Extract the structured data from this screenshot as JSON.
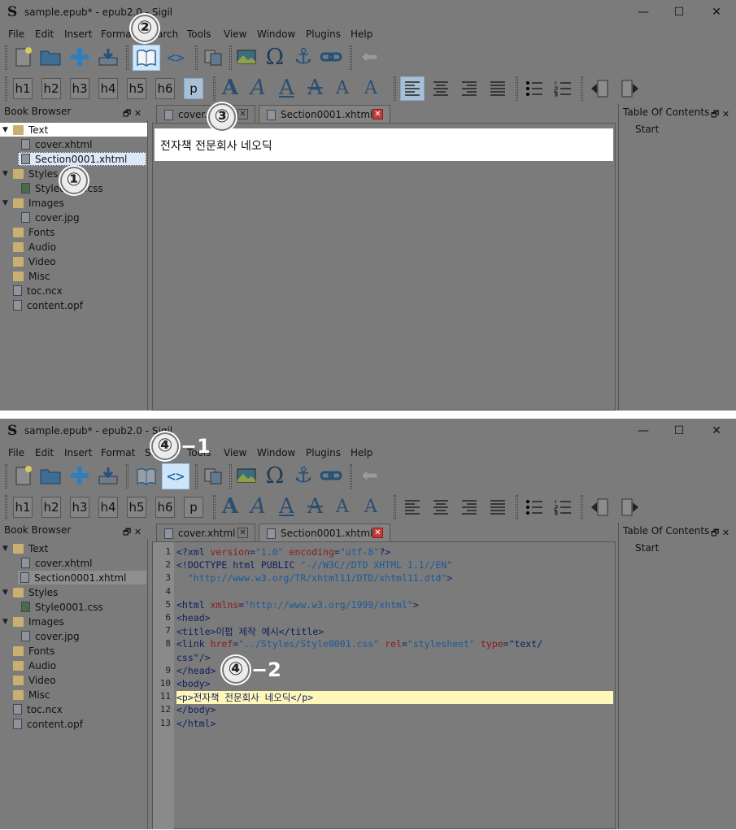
{
  "window_title": "sample.epub* - epub2.0 - Sigil",
  "app_icon": "S",
  "window_controls": {
    "minimize": "—",
    "maximize": "☐",
    "close": "✕"
  },
  "menu": [
    "File",
    "Edit",
    "Insert",
    "Format",
    "Search",
    "Tools",
    "View",
    "Window",
    "Plugins",
    "Help"
  ],
  "heading_buttons": [
    "h1",
    "h2",
    "h3",
    "h4",
    "h5",
    "h6",
    "p"
  ],
  "format_glyphs": [
    "A",
    "A",
    "A",
    "A",
    "A",
    "A"
  ],
  "icons": {
    "new": "new-file-icon",
    "open": "open-folder-icon",
    "add": "add-file-icon",
    "save": "save-icon",
    "book_view": "book-view-icon",
    "code_view": "code-view-icon",
    "metadata": "metadata-icon",
    "image": "insert-image-icon",
    "special_char": "omega-icon",
    "anchor": "anchor-icon",
    "link": "link-icon",
    "back": "back-arrow-icon",
    "align_left": "align-left-icon",
    "align_center": "align-center-icon",
    "align_right": "align-right-icon",
    "justify": "justify-icon",
    "bullet_list": "bullet-list-icon",
    "number_list": "numbered-list-icon",
    "outdent": "outdent-icon",
    "indent": "indent-icon"
  },
  "code_view_glyph": "<>",
  "omega_glyph": "Ω",
  "anchor_glyph": "⚓",
  "book_browser": {
    "title": "Book Browser",
    "items": [
      {
        "label": "Text",
        "type": "folder",
        "level": 0
      },
      {
        "label": "cover.xhtml",
        "type": "file",
        "level": 1
      },
      {
        "label": "Section0001.xhtml",
        "type": "file",
        "level": 1
      },
      {
        "label": "Styles",
        "type": "folder",
        "level": 0
      },
      {
        "label": "Style0001.css",
        "type": "file",
        "level": 1
      },
      {
        "label": "Images",
        "type": "folder",
        "level": 0
      },
      {
        "label": "cover.jpg",
        "type": "file",
        "level": 1
      },
      {
        "label": "Fonts",
        "type": "folder",
        "level": 0
      },
      {
        "label": "Audio",
        "type": "folder",
        "level": 0
      },
      {
        "label": "Video",
        "type": "folder",
        "level": 0
      },
      {
        "label": "Misc",
        "type": "folder",
        "level": 0
      },
      {
        "label": "toc.ncx",
        "type": "file",
        "level": 0
      },
      {
        "label": "content.opf",
        "type": "file",
        "level": 0
      }
    ]
  },
  "tabs": [
    {
      "label": "cover.xhtml"
    },
    {
      "label": "Section0001.xhtml"
    }
  ],
  "toc": {
    "title": "Table Of Contents",
    "items": [
      "Start"
    ]
  },
  "preview_text": "전자책 전문회사 네오딕",
  "code_lines": [
    "<?xml version=\"1.0\" encoding=\"utf-8\"?>",
    "<!DOCTYPE html PUBLIC \"-//W3C//DTD XHTML 1.1//EN\"",
    "  \"http://www.w3.org/TR/xhtml11/DTD/xhtml11.dtd\">",
    "",
    "<html xmlns=\"http://www.w3.org/1999/xhtml\">",
    "<head>",
    "<title>이펍 제작 예시</title>",
    "<link href=\"../Styles/Style0001.css\" rel=\"stylesheet\" type=\"text/",
    "css\"/>",
    "</head>",
    "<body>",
    "<p>전자책 전문회사 네오딕</p>",
    "</body>",
    "</html>"
  ],
  "line_numbers": [
    "1",
    "2",
    "3",
    "4",
    "5",
    "6",
    "7",
    "8",
    "",
    "9",
    "10",
    "11",
    "12",
    "13"
  ],
  "annotations": {
    "b1": "①",
    "b2": "②",
    "b3": "③",
    "b4": "④",
    "b4_1_suffix": "−1",
    "b4_2_suffix": "−2"
  },
  "colors": {
    "tag": "#102060",
    "attr": "#8b1a1a",
    "value": "#1a5a9a",
    "highlight": "#fff7b8"
  }
}
